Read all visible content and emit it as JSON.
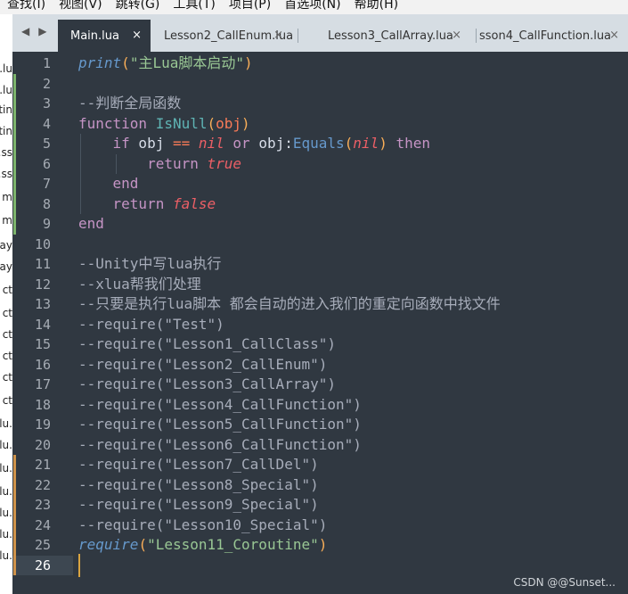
{
  "menu": {
    "items": [
      "查找(I)",
      "视图(V)",
      "跳转(G)",
      "工具(T)",
      "项目(P)",
      "首选项(N)",
      "帮助(H)"
    ]
  },
  "sidebar": {
    "fragments": [
      "al.lu",
      "al.lu",
      "tin",
      "tin",
      "ss.",
      "ss.",
      "m",
      "m",
      "ay.",
      "ay.",
      "ct",
      "ct",
      "ct",
      "ct",
      "ct",
      "ct",
      ".lu",
      ".lu",
      ".lu",
      ".lu",
      ".lu",
      ".lu",
      ".lu"
    ]
  },
  "tabs": [
    {
      "label": "Main.lua",
      "close": "×",
      "active": true
    },
    {
      "label": "Lesson2_CallEnum.lua",
      "close": "×",
      "active": false
    },
    {
      "label": "Lesson3_CallArray.lua",
      "close": "×",
      "active": false
    },
    {
      "label": "sson4_CallFunction.lua",
      "close": "×",
      "active": false
    }
  ],
  "editor": {
    "language": "lua",
    "current_line": 26,
    "lines": [
      {
        "n": "1",
        "tokens": [
          [
            "fnit",
            "print"
          ],
          [
            "par",
            "("
          ],
          [
            "str",
            "\"主Lua脚本启动\""
          ],
          [
            "par",
            ")"
          ]
        ]
      },
      {
        "n": "2",
        "tokens": []
      },
      {
        "n": "3",
        "tokens": [
          [
            "cmt",
            "--判断全局函数"
          ]
        ]
      },
      {
        "n": "4",
        "tokens": [
          [
            "kw",
            "function"
          ],
          [
            "plain",
            " "
          ],
          [
            "fnname",
            "IsNull"
          ],
          [
            "par",
            "("
          ],
          [
            "op",
            "obj"
          ],
          [
            "par",
            ")"
          ]
        ]
      },
      {
        "n": "5",
        "tokens": [
          [
            "plain",
            "    "
          ],
          [
            "kw",
            "if"
          ],
          [
            "plain",
            " obj "
          ],
          [
            "op",
            "=="
          ],
          [
            "plain",
            " "
          ],
          [
            "lit",
            "nil"
          ],
          [
            "plain",
            " "
          ],
          [
            "kw",
            "or"
          ],
          [
            "plain",
            " obj:"
          ],
          [
            "fn",
            "Equals"
          ],
          [
            "par",
            "("
          ],
          [
            "lit",
            "nil"
          ],
          [
            "par",
            ")"
          ],
          [
            "plain",
            " "
          ],
          [
            "kw",
            "then"
          ]
        ]
      },
      {
        "n": "6",
        "tokens": [
          [
            "plain",
            "        "
          ],
          [
            "kw",
            "return"
          ],
          [
            "plain",
            " "
          ],
          [
            "lit",
            "true"
          ]
        ]
      },
      {
        "n": "7",
        "tokens": [
          [
            "plain",
            "    "
          ],
          [
            "kw",
            "end"
          ]
        ]
      },
      {
        "n": "8",
        "tokens": [
          [
            "plain",
            "    "
          ],
          [
            "kw",
            "return"
          ],
          [
            "plain",
            " "
          ],
          [
            "lit",
            "false"
          ]
        ]
      },
      {
        "n": "9",
        "tokens": [
          [
            "kw",
            "end"
          ]
        ]
      },
      {
        "n": "10",
        "tokens": []
      },
      {
        "n": "11",
        "tokens": [
          [
            "cmt",
            "--Unity中写lua执行"
          ]
        ]
      },
      {
        "n": "12",
        "tokens": [
          [
            "cmt",
            "--xlua帮我们处理"
          ]
        ]
      },
      {
        "n": "13",
        "tokens": [
          [
            "cmt",
            "--只要是执行lua脚本 都会自动的进入我们的重定向函数中找文件"
          ]
        ]
      },
      {
        "n": "14",
        "tokens": [
          [
            "cmt",
            "--require(\"Test\")"
          ]
        ]
      },
      {
        "n": "15",
        "tokens": [
          [
            "cmt",
            "--require(\"Lesson1_CallClass\")"
          ]
        ]
      },
      {
        "n": "16",
        "tokens": [
          [
            "cmt",
            "--require(\"Lesson2_CallEnum\")"
          ]
        ]
      },
      {
        "n": "17",
        "tokens": [
          [
            "cmt",
            "--require(\"Lesson3_CallArray\")"
          ]
        ]
      },
      {
        "n": "18",
        "tokens": [
          [
            "cmt",
            "--require(\"Lesson4_CallFunction\")"
          ]
        ]
      },
      {
        "n": "19",
        "tokens": [
          [
            "cmt",
            "--require(\"Lesson5_CallFunction\")"
          ]
        ]
      },
      {
        "n": "20",
        "tokens": [
          [
            "cmt",
            "--require(\"Lesson6_CallFunction\")"
          ]
        ]
      },
      {
        "n": "21",
        "tokens": [
          [
            "cmt",
            "--require(\"Lesson7_CallDel\")"
          ]
        ]
      },
      {
        "n": "22",
        "tokens": [
          [
            "cmt",
            "--require(\"Lesson8_Special\")"
          ]
        ]
      },
      {
        "n": "23",
        "tokens": [
          [
            "cmt",
            "--require(\"Lesson9_Special\")"
          ]
        ]
      },
      {
        "n": "24",
        "tokens": [
          [
            "cmt",
            "--require(\"Lesson10_Special\")"
          ]
        ]
      },
      {
        "n": "25",
        "tokens": [
          [
            "fnit",
            "require"
          ],
          [
            "par",
            "("
          ],
          [
            "str",
            "\"Lesson11_Coroutine\""
          ],
          [
            "par",
            ")"
          ]
        ]
      },
      {
        "n": "26",
        "tokens": []
      }
    ],
    "modified_markers": {
      "green": [
        "2",
        "3",
        "4",
        "5",
        "6",
        "7",
        "8",
        "9"
      ],
      "orange": [
        "21",
        "22",
        "23",
        "24",
        "25",
        "26"
      ]
    }
  },
  "watermark": "CSDN @@Sunset..."
}
